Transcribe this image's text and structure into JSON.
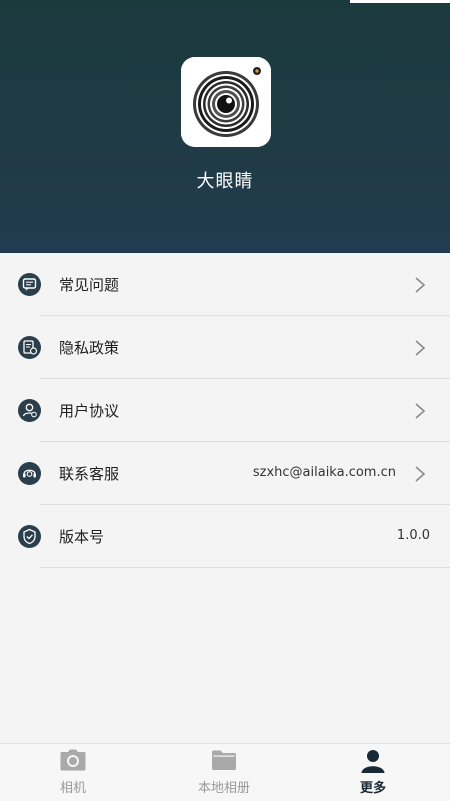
{
  "app": {
    "name": "大眼睛",
    "icon": "camera-lens-app-icon"
  },
  "menu": {
    "items": [
      {
        "label": "常见问题",
        "value": "",
        "icon": "faq-icon",
        "arrow": true
      },
      {
        "label": "隐私政策",
        "value": "",
        "icon": "privacy-icon",
        "arrow": true
      },
      {
        "label": "用户协议",
        "value": "",
        "icon": "user-agreement-icon",
        "arrow": true
      },
      {
        "label": "联系客服",
        "value": "szxhc@ailaika.com.cn",
        "icon": "customer-service-icon",
        "arrow": true
      },
      {
        "label": "版本号",
        "value": "1.0.0",
        "icon": "version-icon",
        "arrow": false
      }
    ]
  },
  "tabbar": {
    "tabs": [
      {
        "label": "相机",
        "icon": "camera-icon",
        "active": false
      },
      {
        "label": "本地相册",
        "icon": "folder-icon",
        "active": false
      },
      {
        "label": "更多",
        "icon": "person-icon",
        "active": true
      }
    ]
  },
  "colors": {
    "header_bg": "#1f3b45",
    "icon_dark": "#2a3e4c",
    "active_tab": "#1a2a35",
    "inactive_tab": "#9a9a9a"
  }
}
